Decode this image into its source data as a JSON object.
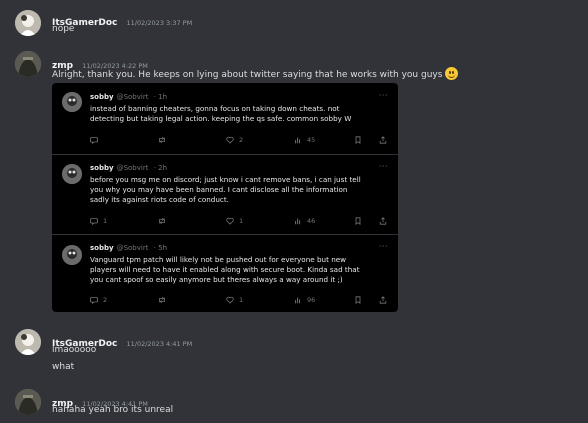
{
  "messages": [
    {
      "user": "ItsGamerDoc",
      "time": "11/02/2023 3:37 PM",
      "lines": [
        "nope"
      ]
    },
    {
      "user": "zmp",
      "time": "11/02/2023 4:22 PM",
      "lines": [
        "Alright, thank you. He keeps on lying about twitter saying that he works with you guys"
      ],
      "emoji": "slightly-smiling-face"
    },
    {
      "user": "ItsGamerDoc",
      "time": "11/02/2023 4:41 PM",
      "lines": [
        "lmaooooo",
        "what"
      ]
    },
    {
      "user": "zmp",
      "time": "11/02/2023 4:41 PM",
      "lines": [
        "hahaha yeah bro its unreal"
      ]
    }
  ],
  "tweets": [
    {
      "name": "sobby",
      "handle": "@Sobvirt",
      "age": "· 1h",
      "text": [
        "instead of banning cheaters, gonna focus on taking down cheats. not",
        "detecting but taking legal action. keeping the qs safe. common sobby W"
      ],
      "replies": "",
      "retweets": "",
      "likes": "2",
      "views": "45"
    },
    {
      "name": "sobby",
      "handle": "@Sobvirt",
      "age": "· 2h",
      "text": [
        "before you msg me on discord; just know i cant remove bans, i can just tell",
        "you why you may have been banned. I cant disclose all the information",
        "sadly its against riots code of conduct."
      ],
      "replies": "1",
      "retweets": "",
      "likes": "1",
      "views": "46"
    },
    {
      "name": "sobby",
      "handle": "@Sobvirt",
      "age": "· 5h",
      "text": [
        "Vanguard tpm patch will likely not be pushed out for everyone but new",
        "players will need to have it enabled along with secure boot. Kinda sad that",
        "you cant spoof so easily anymore but theres always a way around it ;)"
      ],
      "replies": "2",
      "retweets": "",
      "likes": "1",
      "views": "96"
    }
  ],
  "more_glyph": "···",
  "colors": {
    "background": "#313338",
    "username": "#f2f3f5",
    "timestamp": "#949ba4",
    "tweet_bg": "#000000",
    "tweet_meta": "#71767b"
  }
}
